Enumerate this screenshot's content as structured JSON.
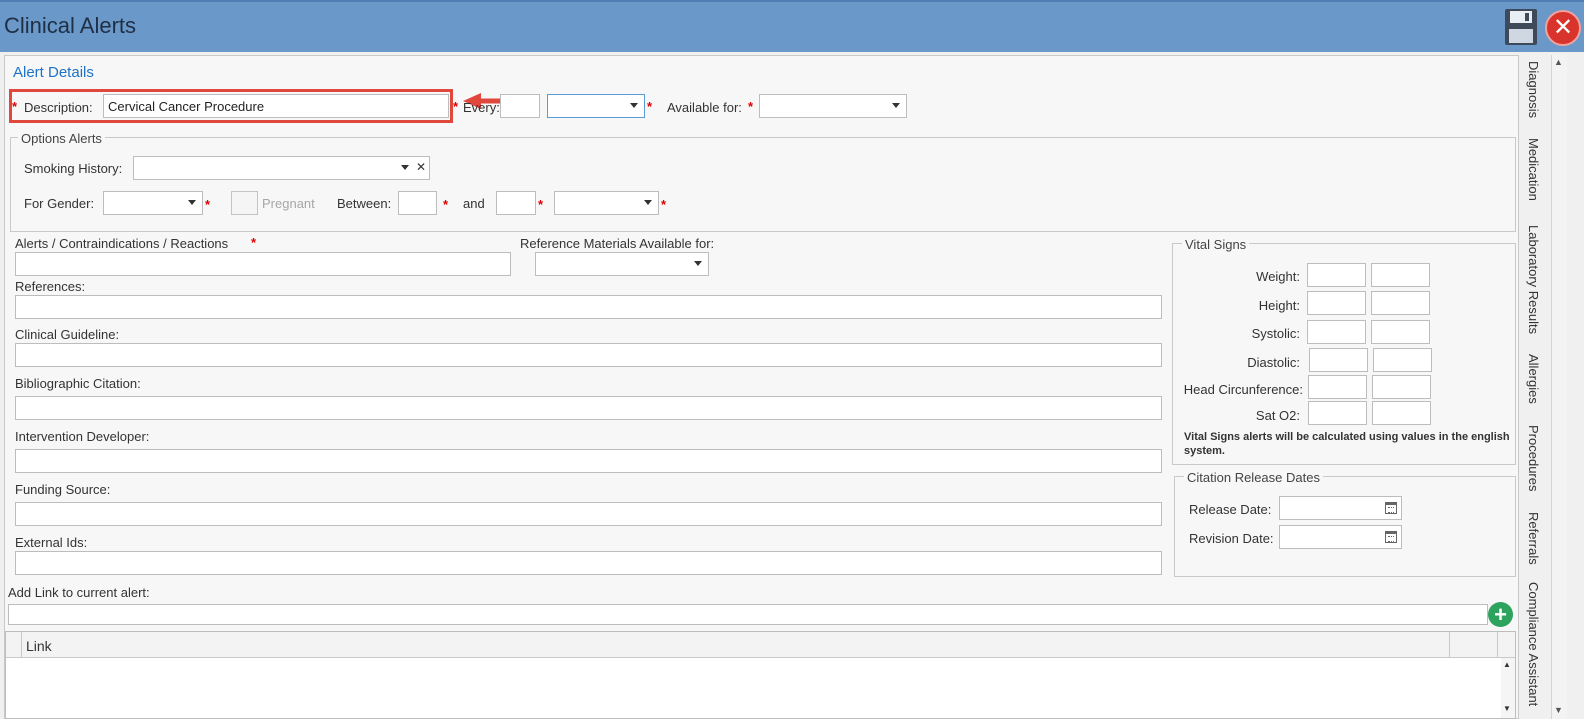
{
  "window": {
    "title": "Clinical Alerts",
    "save_icon": "save-icon",
    "close_icon": "close-icon",
    "close_glyph": "✕"
  },
  "alert_details": {
    "header": "Alert Details",
    "description_label": "Description:",
    "description_value": "Cervical Cancer Procedure",
    "every_label": "Every:",
    "every_value": "",
    "every_unit_value": "",
    "available_for_label": "Available for:",
    "available_for_value": "",
    "required_mark": "*"
  },
  "options_alerts": {
    "legend": "Options Alerts",
    "smoking_history_label": "Smoking History:",
    "smoking_history_value": "",
    "clear_glyph": "✕",
    "for_gender_label": "For Gender:",
    "for_gender_value": "",
    "pregnant_label": "Pregnant",
    "between_label": "Between:",
    "between_value": "",
    "and_label": "and",
    "and_value": "",
    "age_unit_value": ""
  },
  "form": {
    "alerts_label": "Alerts / Contraindications / Reactions",
    "alerts_value": "",
    "reference_materials_label": "Reference Materials Available for:",
    "reference_materials_value": "",
    "references_label": "References:",
    "references_value": "",
    "clinical_guideline_label": "Clinical Guideline:",
    "clinical_guideline_value": "",
    "bibliographic_citation_label": "Bibliographic Citation:",
    "bibliographic_citation_value": "",
    "intervention_developer_label": "Intervention Developer:",
    "intervention_developer_value": "",
    "funding_source_label": "Funding Source:",
    "funding_source_value": "",
    "external_ids_label": "External Ids:",
    "external_ids_value": "",
    "add_link_label": "Add Link to current alert:",
    "add_link_value": "",
    "add_link_glyph": "+"
  },
  "vital_signs": {
    "legend": "Vital Signs",
    "rows": [
      {
        "label": "Weight:"
      },
      {
        "label": "Height:"
      },
      {
        "label": "Systolic:"
      },
      {
        "label": "Diastolic:"
      },
      {
        "label": "Head Circunference:"
      },
      {
        "label": "Sat O2:"
      }
    ],
    "note": "Vital Signs alerts will be calculated using values in the english system."
  },
  "citation_release_dates": {
    "legend": "Citation Release Dates",
    "release_date_label": "Release Date:",
    "release_date_value": "",
    "revision_date_label": "Revision Date:",
    "revision_date_value": ""
  },
  "links_grid": {
    "columns": [
      "Link"
    ]
  },
  "right_tabs": [
    "Diagnosis",
    "Medication",
    "Laboratory Results",
    "Allergies",
    "Procedures",
    "Referrals",
    "Compliance Assistant"
  ],
  "colors": {
    "titlebar": "#6a98c9",
    "required": "#e00000",
    "highlight": "#e0473d",
    "add_button": "#2ea35d",
    "close_button": "#d9342b",
    "header_text": "#1f73c7"
  }
}
